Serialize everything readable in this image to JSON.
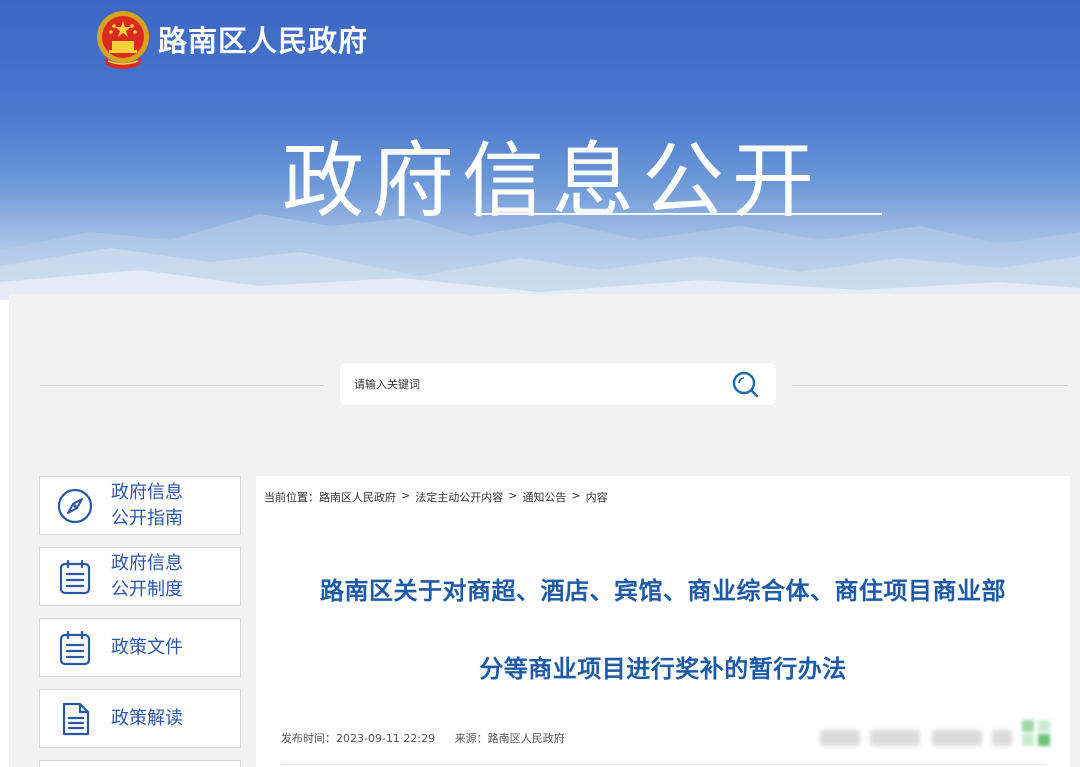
{
  "header": {
    "site_name": "路南区人民政府",
    "hero_title": "政府信息公开",
    "emblem_icon": "national-emblem-icon"
  },
  "search": {
    "placeholder": "请输入关键词",
    "button_icon": "search-icon"
  },
  "sidebar": {
    "items": [
      {
        "label": "政府信息\n公开指南",
        "icon": "compass-icon"
      },
      {
        "label": "政府信息\n公开制度",
        "icon": "list-icon"
      },
      {
        "label": "政策文件",
        "icon": "list-icon"
      },
      {
        "label": "政策解读",
        "icon": "document-icon"
      }
    ]
  },
  "breadcrumb": {
    "prefix": "当前位置：",
    "items": [
      "路南区人民政府",
      "法定主动公开内容",
      "通知公告",
      "内容"
    ],
    "separator": ">"
  },
  "article": {
    "title_line1": "路南区关于对商超、酒店、宾馆、商业综合体、商住项目商业部",
    "title_line2": "分等商业项目进行奖补的暂行办法",
    "publish_label": "发布时间：",
    "publish_time": "2023-09-11 22:29",
    "source_label": "来源：",
    "source": "路南区人民政府"
  },
  "colors": {
    "banner_blue": "#3c66c2",
    "title_blue": "#1f5aa6",
    "sidebar_text": "#2a57a8",
    "panel_bg": "#f2f2f2"
  }
}
